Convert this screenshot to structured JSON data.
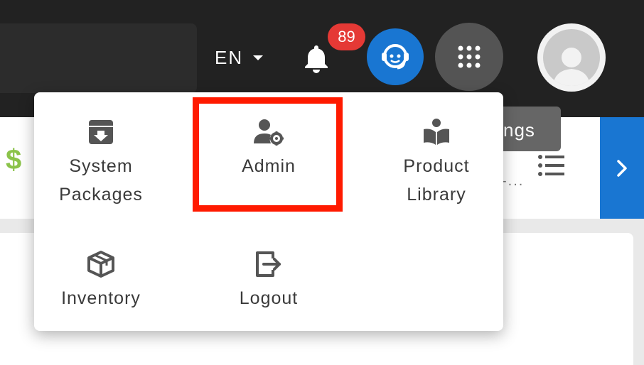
{
  "header": {
    "language": "EN",
    "notifications_count": "89"
  },
  "background": {
    "currency_symbol": "$",
    "tooltip_text": "ngs",
    "truncated_text": "-..."
  },
  "menu": {
    "items": [
      {
        "label_line1": "System",
        "label_line2": "Packages",
        "icon": "archive-box-icon"
      },
      {
        "label_line1": "Admin",
        "label_line2": "",
        "icon": "user-gear-icon"
      },
      {
        "label_line1": "Product",
        "label_line2": "Library",
        "icon": "book-reader-icon"
      },
      {
        "label_line1": "Inventory",
        "label_line2": "",
        "icon": "box-icon"
      },
      {
        "label_line1": "Logout",
        "label_line2": "",
        "icon": "logout-icon"
      }
    ]
  },
  "colors": {
    "topbar": "#222222",
    "accent_blue": "#1976d2",
    "badge_red": "#e53935",
    "highlight_red": "#ff1a00",
    "dollar_green": "#8bc34a"
  }
}
